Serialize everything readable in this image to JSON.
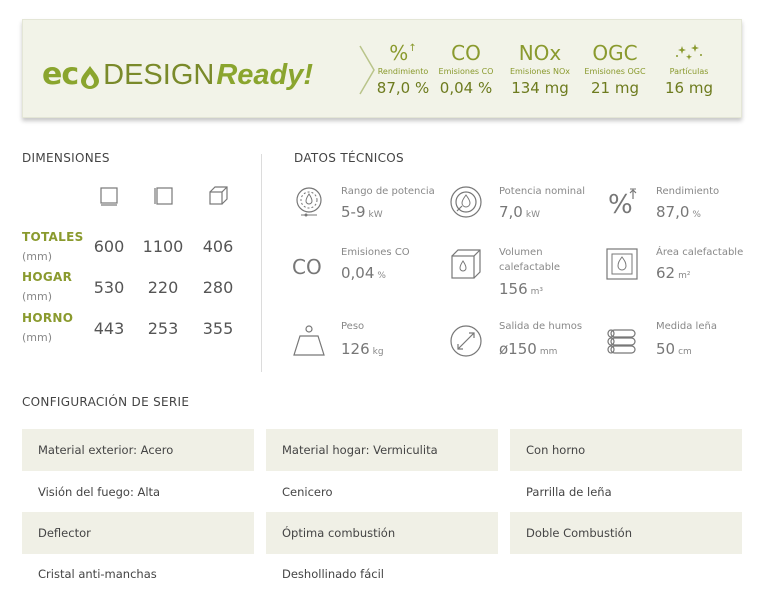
{
  "eco": {
    "logo_eco": "ec",
    "logo_design": "DESIGN",
    "logo_ready": "Ready!",
    "metrics": [
      {
        "symbol": "%",
        "label": "Rendimiento",
        "value": "87,0 %",
        "icon": "percent-icon"
      },
      {
        "symbol": "CO",
        "label": "Emisiones CO",
        "value": "0,04 %",
        "icon": ""
      },
      {
        "symbol": "NOx",
        "label": "Emisiones NOx",
        "value": "134 mg",
        "icon": ""
      },
      {
        "symbol": "OGC",
        "label": "Emisiones OGC",
        "value": "21 mg",
        "icon": ""
      },
      {
        "symbol": "",
        "label": "Partículas",
        "value": "16 mg",
        "icon": "sparkles-icon"
      }
    ],
    "colors": {
      "accent": "#8aa52e",
      "dark_accent": "#6d7b1e",
      "banner_bg": "#f2f3e8"
    }
  },
  "dimensions": {
    "title": "DIMENSIONES",
    "icons": [
      "width-icon",
      "height-icon",
      "depth-icon"
    ],
    "rows": [
      {
        "label": "TOTALES",
        "unit": "(mm)",
        "values": [
          "600",
          "1100",
          "406"
        ]
      },
      {
        "label": "HOGAR",
        "unit": "(mm)",
        "values": [
          "530",
          "220",
          "280"
        ]
      },
      {
        "label": "HORNO",
        "unit": "(mm)",
        "values": [
          "443",
          "253",
          "355"
        ]
      }
    ]
  },
  "tech": {
    "title": "DATOS TÉCNICOS",
    "items": [
      {
        "label": "Rango de potencia",
        "value": "5-9",
        "unit": "kW",
        "icon": "power-range-icon"
      },
      {
        "label": "Potencia nominal",
        "value": "7,0",
        "unit": "kW",
        "icon": "nominal-power-icon"
      },
      {
        "label": "Rendimiento",
        "value": "87,0",
        "unit": "%",
        "icon": "efficiency-icon"
      },
      {
        "label": "Emisiones CO",
        "value": "0,04",
        "unit": "%",
        "icon": "co-icon",
        "icon_text": "CO"
      },
      {
        "label": "Volumen calefactable",
        "value": "156",
        "unit": "m³",
        "icon": "volume-icon"
      },
      {
        "label": "Área calefactable",
        "value": "62",
        "unit": "m²",
        "icon": "area-icon"
      },
      {
        "label": "Peso",
        "value": "126",
        "unit": "kg",
        "icon": "weight-icon"
      },
      {
        "label": "Salida de humos",
        "value": "ø150",
        "unit": "mm",
        "icon": "flue-outlet-icon"
      },
      {
        "label": "Medida leña",
        "value": "50",
        "unit": "cm",
        "icon": "firewood-icon"
      }
    ]
  },
  "config": {
    "title": "CONFIGURACIÓN DE SERIE",
    "items": [
      "Material exterior: Acero",
      "Material hogar: Vermiculita",
      "Con horno",
      "Visión del fuego: Alta",
      "Cenicero",
      "Parrilla de leña",
      "Deflector",
      "Óptima combustión",
      "Doble Combustión",
      "Cristal anti-manchas",
      "Deshollinado fácil"
    ]
  }
}
